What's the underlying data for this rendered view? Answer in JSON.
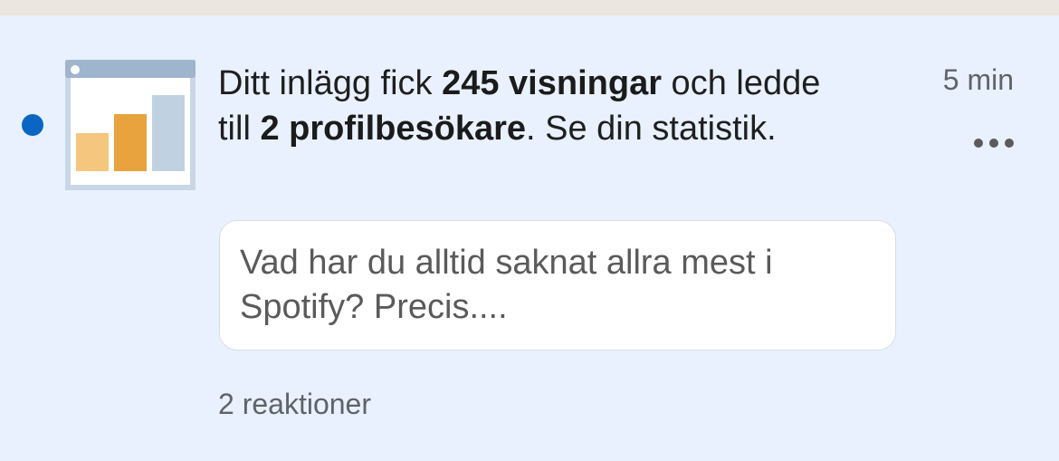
{
  "notification": {
    "message": {
      "part1": "Ditt inlägg fick ",
      "views": "245 visningar",
      "part2": " och ledde till ",
      "profile_visits": "2 profilbesökare",
      "part3": ". Se din statistik."
    },
    "time": "5 min",
    "quote": "Vad har du alltid saknat allra mest i Spotify? Precis....",
    "reactions": "2 reaktioner",
    "thumbnail_icon": "analytics-chart-icon",
    "more_icon": "more-options-icon"
  },
  "colors": {
    "background": "#e8f1fd",
    "unread_dot": "#0a66c2",
    "bar_light": "#f5c67e",
    "bar_dark": "#e8a33e",
    "bar_blue": "#c0d1e2",
    "window_bar": "#9fb5ce"
  }
}
